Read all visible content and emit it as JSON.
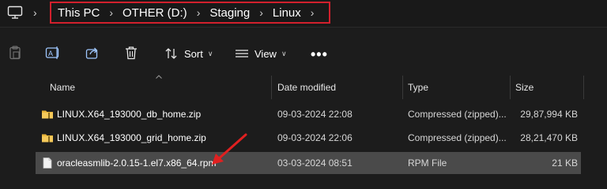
{
  "address_bar": {
    "pc_icon": "monitor-icon",
    "crumbs": [
      "This PC",
      "OTHER (D:)",
      "Staging",
      "Linux"
    ],
    "highlight_color": "#d2202d"
  },
  "toolbar": {
    "sort_label": "Sort",
    "view_label": "View",
    "more_label": "•••"
  },
  "columns": {
    "name": "Name",
    "date": "Date modified",
    "type": "Type",
    "size": "Size"
  },
  "files": [
    {
      "name": "LINUX.X64_193000_db_home.zip",
      "date": "09-03-2024 22:08",
      "type": "Compressed (zipped)...",
      "size": "29,87,994 KB",
      "icon": "zip-folder-icon"
    },
    {
      "name": "LINUX.X64_193000_grid_home.zip",
      "date": "09-03-2024 22:06",
      "type": "Compressed (zipped)...",
      "size": "28,21,470 KB",
      "icon": "zip-folder-icon"
    },
    {
      "name": "oracleasmlib-2.0.15-1.el7.x86_64.rpm",
      "date": "03-03-2024 08:51",
      "type": "RPM File",
      "size": "21 KB",
      "icon": "file-icon",
      "selected": true
    }
  ],
  "annotation_color": "#e02020"
}
